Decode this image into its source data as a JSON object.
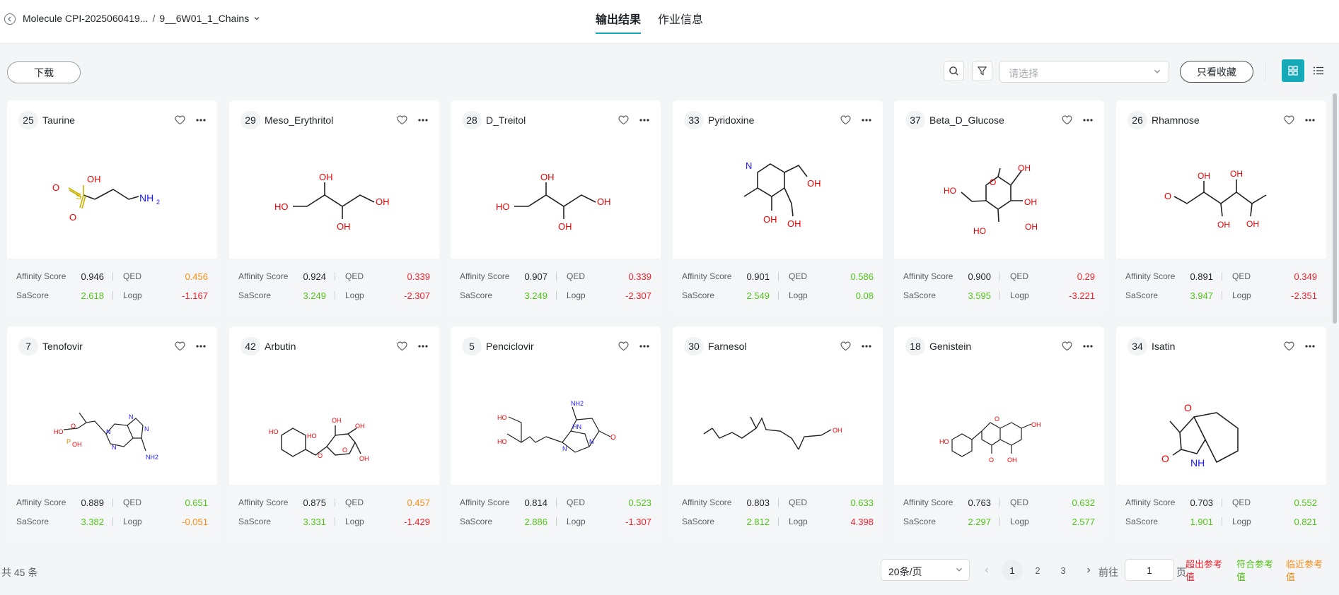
{
  "header": {
    "breadcrumb_project": "Molecule CPI-2025060419...",
    "breadcrumb_sep": "/",
    "breadcrumb_task": "9__6W01_1_Chains",
    "tabs": [
      {
        "label": "输出结果",
        "active": true
      },
      {
        "label": "作业信息",
        "active": false
      }
    ]
  },
  "toolbar": {
    "download_label": "下载",
    "select_placeholder": "请选择",
    "favorites_only_label": "只看收藏"
  },
  "labels": {
    "affinity": "Affinity Score",
    "qed": "QED",
    "sascore": "SaScore",
    "logp": "Logp"
  },
  "colors": {
    "accent": "#16a9b8",
    "good": "#52c41a",
    "bad": "#f5222d",
    "near": "#fa8c16"
  },
  "cards": [
    {
      "id": "25",
      "name": "Taurine",
      "affinity": "0.946",
      "qed": "0.456",
      "qed_status": "orange",
      "sascore": "2.618",
      "sascore_status": "green",
      "logp": "-1.167",
      "logp_status": "red"
    },
    {
      "id": "29",
      "name": "Meso_Erythritol",
      "affinity": "0.924",
      "qed": "0.339",
      "qed_status": "red",
      "sascore": "3.249",
      "sascore_status": "green",
      "logp": "-2.307",
      "logp_status": "red"
    },
    {
      "id": "28",
      "name": "D_Treitol",
      "affinity": "0.907",
      "qed": "0.339",
      "qed_status": "red",
      "sascore": "3.249",
      "sascore_status": "green",
      "logp": "-2.307",
      "logp_status": "red"
    },
    {
      "id": "33",
      "name": "Pyridoxine",
      "affinity": "0.901",
      "qed": "0.586",
      "qed_status": "green",
      "sascore": "2.549",
      "sascore_status": "green",
      "logp": "0.08",
      "logp_status": "green"
    },
    {
      "id": "37",
      "name": "Beta_D_Glucose",
      "affinity": "0.900",
      "qed": "0.29",
      "qed_status": "red",
      "sascore": "3.595",
      "sascore_status": "green",
      "logp": "-3.221",
      "logp_status": "red"
    },
    {
      "id": "26",
      "name": "Rhamnose",
      "affinity": "0.891",
      "qed": "0.349",
      "qed_status": "red",
      "sascore": "3.947",
      "sascore_status": "green",
      "logp": "-2.351",
      "logp_status": "red"
    },
    {
      "id": "7",
      "name": "Tenofovir",
      "affinity": "0.889",
      "qed": "0.651",
      "qed_status": "green",
      "sascore": "3.382",
      "sascore_status": "green",
      "logp": "-0.051",
      "logp_status": "orange"
    },
    {
      "id": "42",
      "name": "Arbutin",
      "affinity": "0.875",
      "qed": "0.457",
      "qed_status": "orange",
      "sascore": "3.331",
      "sascore_status": "green",
      "logp": "-1.429",
      "logp_status": "red"
    },
    {
      "id": "5",
      "name": "Penciclovir",
      "affinity": "0.814",
      "qed": "0.523",
      "qed_status": "green",
      "sascore": "2.886",
      "sascore_status": "green",
      "logp": "-1.307",
      "logp_status": "red"
    },
    {
      "id": "30",
      "name": "Farnesol",
      "affinity": "0.803",
      "qed": "0.633",
      "qed_status": "green",
      "sascore": "2.812",
      "sascore_status": "green",
      "logp": "4.398",
      "logp_status": "red"
    },
    {
      "id": "18",
      "name": "Genistein",
      "affinity": "0.763",
      "qed": "0.632",
      "qed_status": "green",
      "sascore": "2.297",
      "sascore_status": "green",
      "logp": "2.577",
      "logp_status": "green"
    },
    {
      "id": "34",
      "name": "Isatin",
      "affinity": "0.703",
      "qed": "0.552",
      "qed_status": "green",
      "sascore": "1.901",
      "sascore_status": "green",
      "logp": "0.821",
      "logp_status": "green"
    }
  ],
  "footer": {
    "total": "共 45 条",
    "page_size": "20条/页",
    "pages": [
      "1",
      "2",
      "3"
    ],
    "current_page": "1",
    "goto_label": "前往",
    "goto_value": "1",
    "page_suffix": "页",
    "legend": [
      {
        "label": "超出参考值",
        "color": "#f5222d"
      },
      {
        "label": "符合参考值",
        "color": "#52c41a"
      },
      {
        "label": "临近参考值",
        "color": "#fa8c16"
      }
    ]
  }
}
